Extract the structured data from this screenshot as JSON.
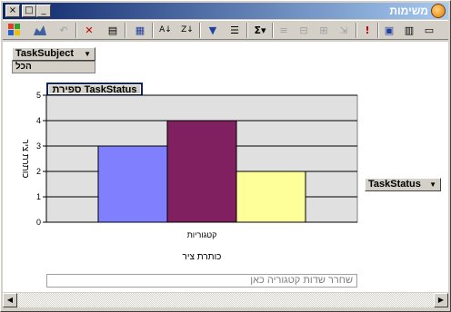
{
  "window": {
    "title": "משימות",
    "controls": {
      "minimize": "_",
      "maximize": "□",
      "close": "×"
    }
  },
  "toolbar": {
    "icons": [
      "office-logo-icon",
      "chart-type-icon",
      "undo-icon",
      "delete-icon",
      "properties-icon",
      "field-list-icon",
      "sort-ascending-icon",
      "sort-descending-icon",
      "autofilter-icon",
      "show-top-icon",
      "autocalc-icon",
      "subtotal-icon",
      "collapse-icon",
      "expand-icon",
      "drill-icon",
      "by-row-column-icon",
      "bubble-icon",
      "legend-icon",
      "help-icon",
      "export-icon"
    ]
  },
  "filter": {
    "field_label": "TaskSubject",
    "value": "הכל"
  },
  "data_field_label": "ספירת TaskStatus",
  "series_field_label": "TaskStatus",
  "category_drop_zone": "שחרר שדות קטגוריה כאן",
  "chart_data": {
    "type": "bar",
    "categories": [
      "קטגוריות"
    ],
    "series": [
      {
        "values": [
          3
        ],
        "color": "#8080ff"
      },
      {
        "values": [
          4
        ],
        "color": "#802060"
      },
      {
        "values": [
          2
        ],
        "color": "#ffff99"
      }
    ],
    "ylim": [
      0,
      5
    ],
    "yticks": [
      0,
      1,
      2,
      3,
      4,
      5
    ],
    "xlabel": "כותרת ציר",
    "ylabel": "כותרת ציר",
    "grid": true,
    "plot_background": "#e0e0e0"
  }
}
